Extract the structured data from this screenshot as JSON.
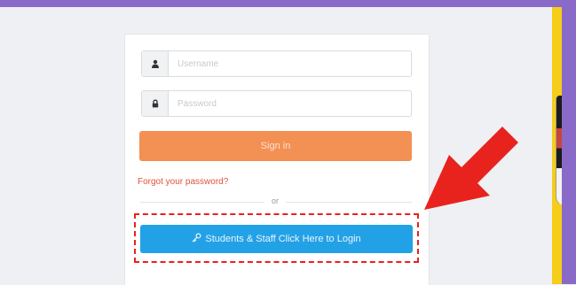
{
  "login_form": {
    "username_placeholder": "Username",
    "password_placeholder": "Password",
    "signin_label": "Sign in",
    "forgot_password_label": "Forgot your password?",
    "or_label": "or",
    "sso_label": "Students & Staff Click Here to Login"
  },
  "icons": {
    "username": "user-icon",
    "password": "lock-icon",
    "sso": "key-icon",
    "annotation": "red-arrow-icon"
  },
  "colors": {
    "frame_purple": "#8a6ac9",
    "side_yellow": "#f6cd18",
    "signin_orange": "#f39053",
    "sso_blue": "#23a1e6",
    "forgot_link_red": "#e0523b",
    "annotation_red": "#e8221d",
    "page_background": "#eef0f3"
  }
}
